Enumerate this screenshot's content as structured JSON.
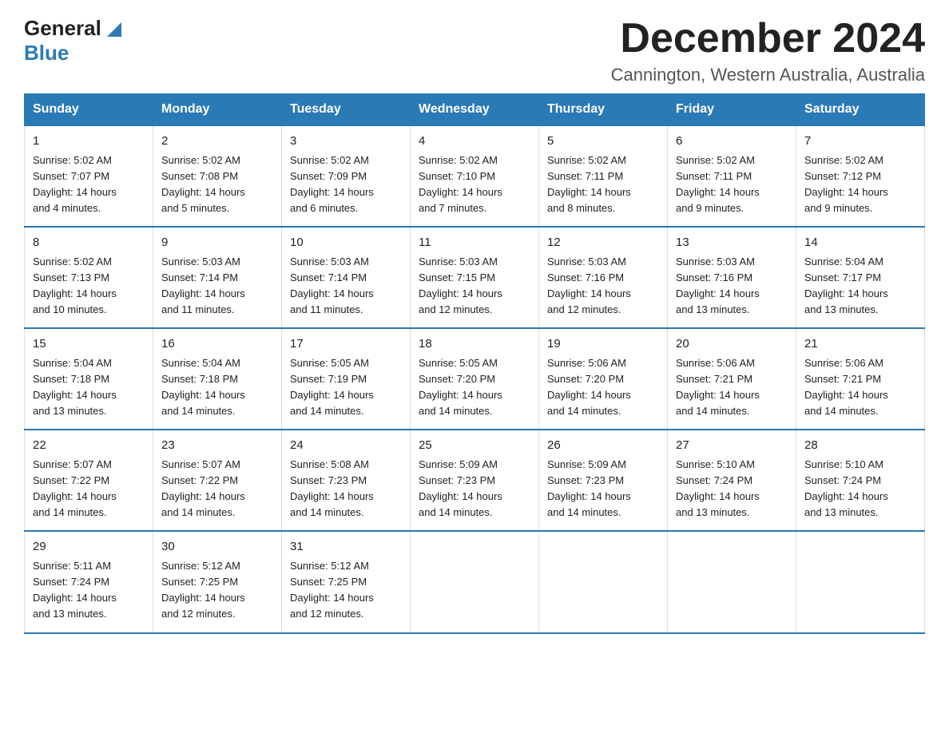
{
  "logo": {
    "general": "General",
    "blue": "Blue"
  },
  "title": "December 2024",
  "location": "Cannington, Western Australia, Australia",
  "weekdays": [
    "Sunday",
    "Monday",
    "Tuesday",
    "Wednesday",
    "Thursday",
    "Friday",
    "Saturday"
  ],
  "weeks": [
    [
      {
        "day": "1",
        "sunrise": "5:02 AM",
        "sunset": "7:07 PM",
        "daylight": "14 hours and 4 minutes."
      },
      {
        "day": "2",
        "sunrise": "5:02 AM",
        "sunset": "7:08 PM",
        "daylight": "14 hours and 5 minutes."
      },
      {
        "day": "3",
        "sunrise": "5:02 AM",
        "sunset": "7:09 PM",
        "daylight": "14 hours and 6 minutes."
      },
      {
        "day": "4",
        "sunrise": "5:02 AM",
        "sunset": "7:10 PM",
        "daylight": "14 hours and 7 minutes."
      },
      {
        "day": "5",
        "sunrise": "5:02 AM",
        "sunset": "7:11 PM",
        "daylight": "14 hours and 8 minutes."
      },
      {
        "day": "6",
        "sunrise": "5:02 AM",
        "sunset": "7:11 PM",
        "daylight": "14 hours and 9 minutes."
      },
      {
        "day": "7",
        "sunrise": "5:02 AM",
        "sunset": "7:12 PM",
        "daylight": "14 hours and 9 minutes."
      }
    ],
    [
      {
        "day": "8",
        "sunrise": "5:02 AM",
        "sunset": "7:13 PM",
        "daylight": "14 hours and 10 minutes."
      },
      {
        "day": "9",
        "sunrise": "5:03 AM",
        "sunset": "7:14 PM",
        "daylight": "14 hours and 11 minutes."
      },
      {
        "day": "10",
        "sunrise": "5:03 AM",
        "sunset": "7:14 PM",
        "daylight": "14 hours and 11 minutes."
      },
      {
        "day": "11",
        "sunrise": "5:03 AM",
        "sunset": "7:15 PM",
        "daylight": "14 hours and 12 minutes."
      },
      {
        "day": "12",
        "sunrise": "5:03 AM",
        "sunset": "7:16 PM",
        "daylight": "14 hours and 12 minutes."
      },
      {
        "day": "13",
        "sunrise": "5:03 AM",
        "sunset": "7:16 PM",
        "daylight": "14 hours and 13 minutes."
      },
      {
        "day": "14",
        "sunrise": "5:04 AM",
        "sunset": "7:17 PM",
        "daylight": "14 hours and 13 minutes."
      }
    ],
    [
      {
        "day": "15",
        "sunrise": "5:04 AM",
        "sunset": "7:18 PM",
        "daylight": "14 hours and 13 minutes."
      },
      {
        "day": "16",
        "sunrise": "5:04 AM",
        "sunset": "7:18 PM",
        "daylight": "14 hours and 14 minutes."
      },
      {
        "day": "17",
        "sunrise": "5:05 AM",
        "sunset": "7:19 PM",
        "daylight": "14 hours and 14 minutes."
      },
      {
        "day": "18",
        "sunrise": "5:05 AM",
        "sunset": "7:20 PM",
        "daylight": "14 hours and 14 minutes."
      },
      {
        "day": "19",
        "sunrise": "5:06 AM",
        "sunset": "7:20 PM",
        "daylight": "14 hours and 14 minutes."
      },
      {
        "day": "20",
        "sunrise": "5:06 AM",
        "sunset": "7:21 PM",
        "daylight": "14 hours and 14 minutes."
      },
      {
        "day": "21",
        "sunrise": "5:06 AM",
        "sunset": "7:21 PM",
        "daylight": "14 hours and 14 minutes."
      }
    ],
    [
      {
        "day": "22",
        "sunrise": "5:07 AM",
        "sunset": "7:22 PM",
        "daylight": "14 hours and 14 minutes."
      },
      {
        "day": "23",
        "sunrise": "5:07 AM",
        "sunset": "7:22 PM",
        "daylight": "14 hours and 14 minutes."
      },
      {
        "day": "24",
        "sunrise": "5:08 AM",
        "sunset": "7:23 PM",
        "daylight": "14 hours and 14 minutes."
      },
      {
        "day": "25",
        "sunrise": "5:09 AM",
        "sunset": "7:23 PM",
        "daylight": "14 hours and 14 minutes."
      },
      {
        "day": "26",
        "sunrise": "5:09 AM",
        "sunset": "7:23 PM",
        "daylight": "14 hours and 14 minutes."
      },
      {
        "day": "27",
        "sunrise": "5:10 AM",
        "sunset": "7:24 PM",
        "daylight": "14 hours and 13 minutes."
      },
      {
        "day": "28",
        "sunrise": "5:10 AM",
        "sunset": "7:24 PM",
        "daylight": "14 hours and 13 minutes."
      }
    ],
    [
      {
        "day": "29",
        "sunrise": "5:11 AM",
        "sunset": "7:24 PM",
        "daylight": "14 hours and 13 minutes."
      },
      {
        "day": "30",
        "sunrise": "5:12 AM",
        "sunset": "7:25 PM",
        "daylight": "14 hours and 12 minutes."
      },
      {
        "day": "31",
        "sunrise": "5:12 AM",
        "sunset": "7:25 PM",
        "daylight": "14 hours and 12 minutes."
      },
      null,
      null,
      null,
      null
    ]
  ],
  "labels": {
    "sunrise": "Sunrise:",
    "sunset": "Sunset:",
    "daylight": "Daylight:"
  }
}
